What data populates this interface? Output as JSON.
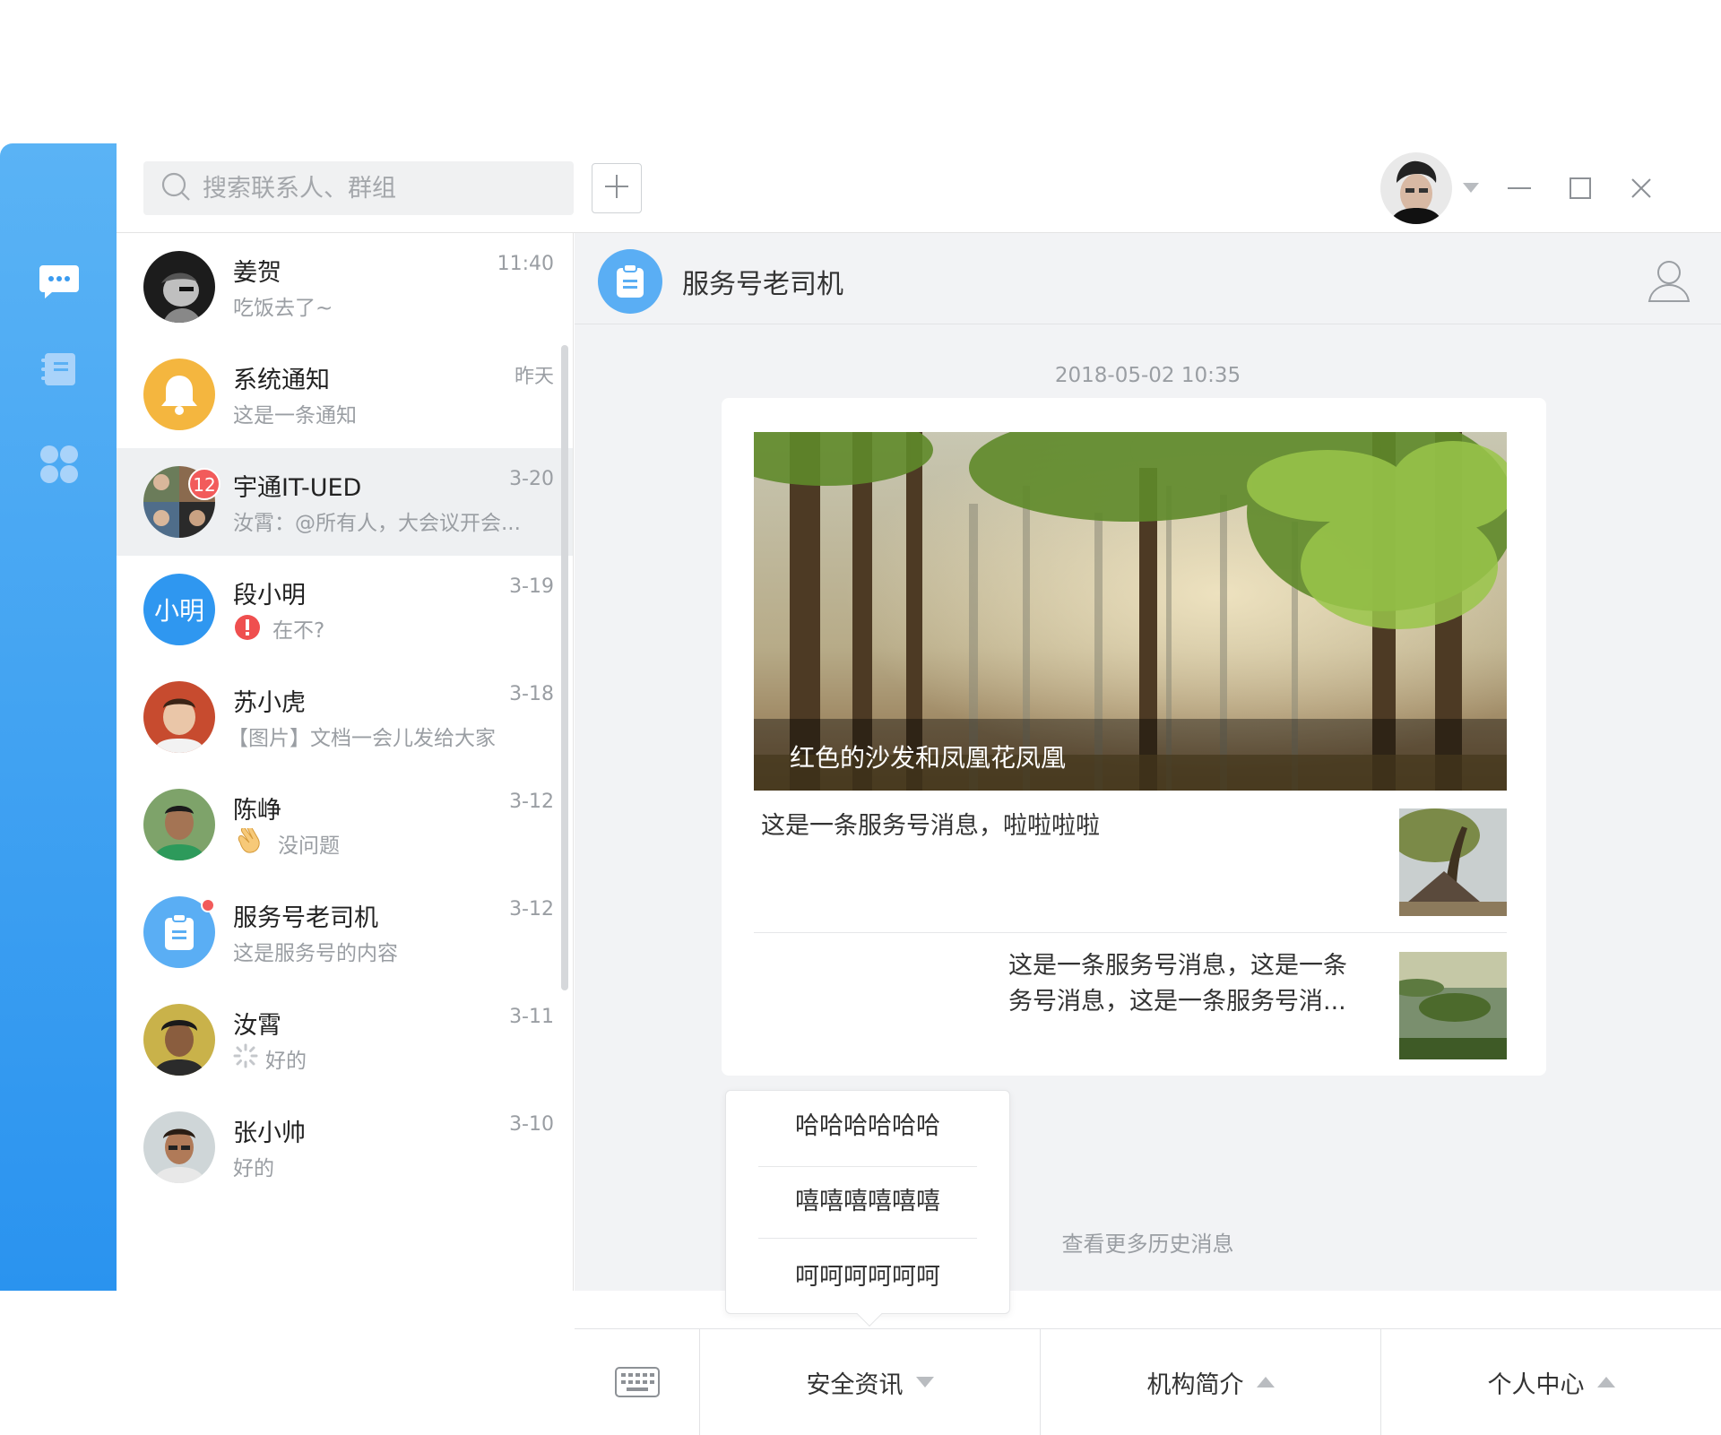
{
  "search": {
    "placeholder": "搜索联系人、群组"
  },
  "conversations": [
    {
      "name": "姜贺",
      "time": "11:40",
      "preview": "吃饭去了~"
    },
    {
      "name": "系统通知",
      "time": "昨天",
      "preview": "这是一条通知"
    },
    {
      "name": "宇通IT-UED",
      "time": "3-20",
      "preview": "汝霄：@所有人，大会议开会...",
      "badge": "12"
    },
    {
      "name": "段小明",
      "time": "3-19",
      "preview": "在不?",
      "avatar_text": "小明"
    },
    {
      "name": "苏小虎",
      "time": "3-18",
      "preview": "【图片】文档一会儿发给大家"
    },
    {
      "name": "陈峥",
      "time": "3-12",
      "preview": "没问题"
    },
    {
      "name": "服务号老司机",
      "time": "3-12",
      "preview": "这是服务号的内容"
    },
    {
      "name": "汝霄",
      "time": "3-11",
      "preview": "好的"
    },
    {
      "name": "张小帅",
      "time": "3-10",
      "preview": "好的"
    }
  ],
  "chat": {
    "title": "服务号老司机",
    "timestamp": "2018-05-02  10:35",
    "hero_caption": "红色的沙发和凤凰花凤凰",
    "items": [
      {
        "text": "这是一条服务号消息，啦啦啦啦"
      },
      {
        "text_line1": "这是一条服务号消息，这是一条",
        "text_line2": "务号消息，这是一条服务号消..."
      }
    ],
    "more_history": "查看更多历史消息"
  },
  "submenu": [
    "哈哈哈哈哈哈",
    "嘻嘻嘻嘻嘻嘻",
    "呵呵呵呵呵呵"
  ],
  "bottom_menu": [
    "安全资讯",
    "机构简介",
    "个人中心"
  ],
  "colors": {
    "accent": "#2f97f0",
    "badge": "#f25b5b",
    "notify": "#f4b63f"
  }
}
